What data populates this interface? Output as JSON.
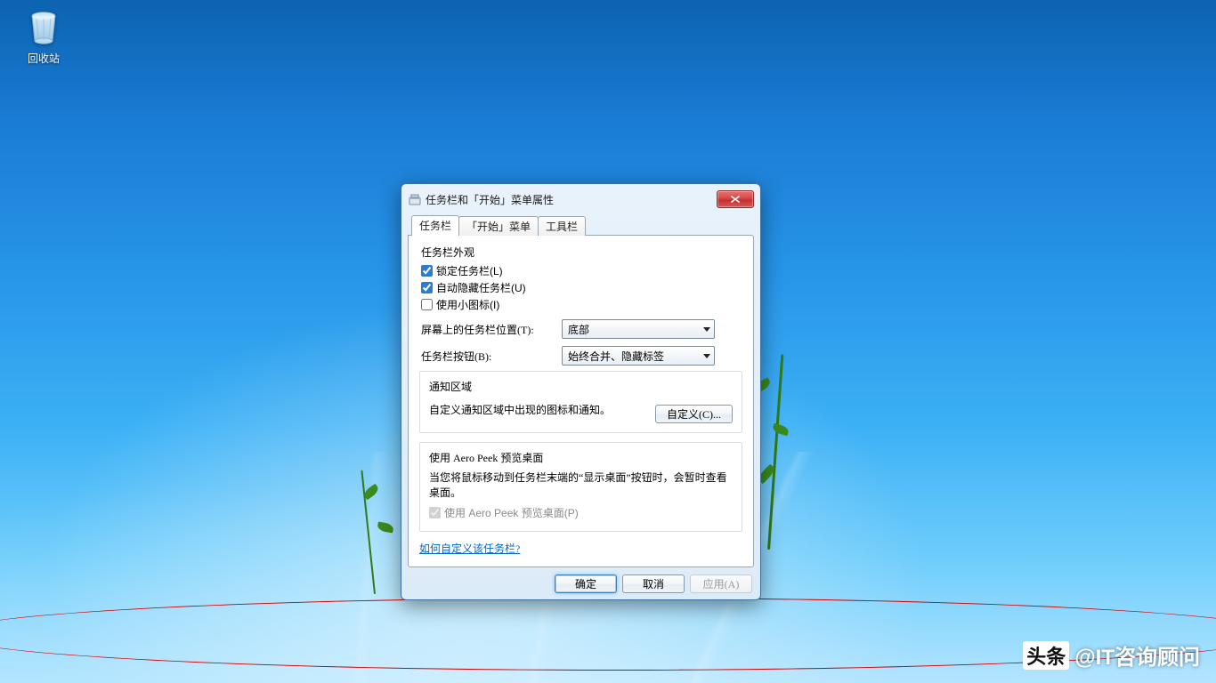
{
  "desktop": {
    "recycle_bin_label": "回收站"
  },
  "dialog": {
    "title": "任务栏和「开始」菜单属性",
    "tabs": [
      "任务栏",
      "「开始」菜单",
      "工具栏"
    ],
    "active_tab_index": 0,
    "section_appearance": {
      "legend": "任务栏外观",
      "lock_label": "锁定任务栏(L)",
      "lock_checked": true,
      "autohide_label": "自动隐藏任务栏(U)",
      "autohide_checked": true,
      "small_icons_label": "使用小图标(I)",
      "small_icons_checked": false,
      "position_label": "屏幕上的任务栏位置(T):",
      "position_value": "底部",
      "buttons_label": "任务栏按钮(B):",
      "buttons_value": "始终合并、隐藏标签"
    },
    "section_notify": {
      "legend": "通知区域",
      "desc": "自定义通知区域中出现的图标和通知。",
      "customize_btn": "自定义(C)..."
    },
    "section_peek": {
      "legend": "使用 Aero Peek 预览桌面",
      "desc": "当您将鼠标移动到任务栏末端的“显示桌面”按钮时，会暂时查看桌面。",
      "checkbox_label": "使用 Aero Peek 预览桌面(P)",
      "checkbox_checked": true,
      "checkbox_disabled": true
    },
    "help_link": "如何自定义该任务栏?",
    "buttons": {
      "ok": "确定",
      "cancel": "取消",
      "apply": "应用(A)"
    }
  },
  "watermark": {
    "prefix": "头条",
    "handle": "@IT咨询顾问"
  }
}
